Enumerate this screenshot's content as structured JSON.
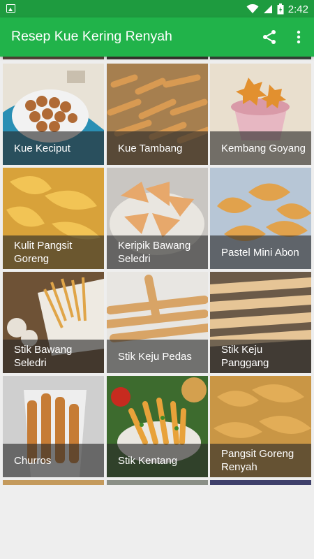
{
  "status_bar": {
    "time": "2:42"
  },
  "app_bar": {
    "title": "Resep Kue Kering Renyah",
    "actions": [
      {
        "icon": "share-icon"
      },
      {
        "icon": "more-vert-icon"
      }
    ]
  },
  "grid": {
    "items": [
      {
        "label": "Kue Keciput"
      },
      {
        "label": "Kue Tambang"
      },
      {
        "label": "Kembang Goyang"
      },
      {
        "label": "Kulit Pangsit Goreng"
      },
      {
        "label": "Keripik Bawang Seledri"
      },
      {
        "label": "Pastel Mini Abon"
      },
      {
        "label": "Stik Bawang Seledri"
      },
      {
        "label": "Stik Keju Pedas"
      },
      {
        "label": "Stik Keju Panggang"
      },
      {
        "label": "Churros"
      },
      {
        "label": "Stik Kentang"
      },
      {
        "label": "Pangsit Goreng Renyah"
      }
    ]
  },
  "colors": {
    "status_bar": "#1e9b3f",
    "app_bar": "#21b34a",
    "background": "#eeeeee"
  }
}
